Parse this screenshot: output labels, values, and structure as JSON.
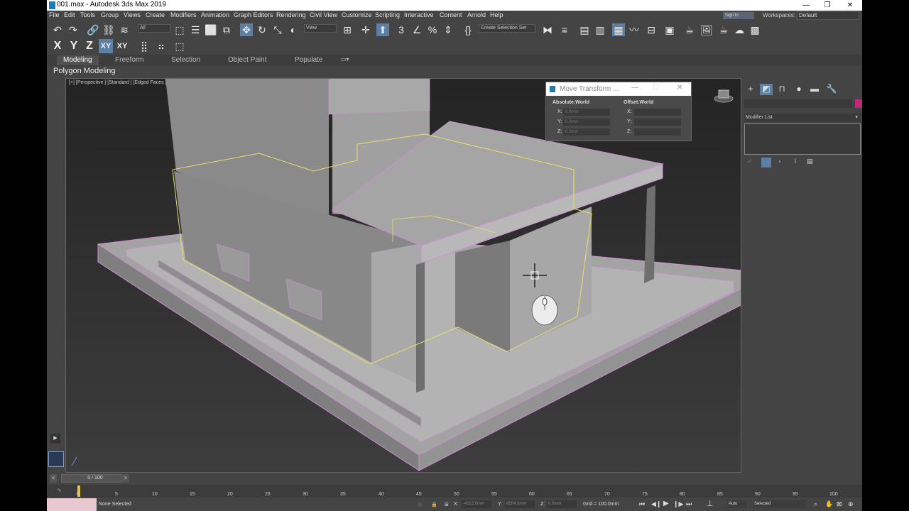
{
  "window": {
    "title": "001.max - Autodesk 3ds Max 2019",
    "min": "—",
    "max": "❐",
    "close": "✕"
  },
  "menubar": {
    "items": [
      "File",
      "Edit",
      "Tools",
      "Group",
      "Views",
      "Create",
      "Modifiers",
      "Animation",
      "Graph Editors",
      "Rendering",
      "Civil View",
      "Customize",
      "Scripting",
      "Interactive",
      "Content",
      "Arnold",
      "Help"
    ],
    "sign_in": "Sign In",
    "workspaces_label": "Workspaces:",
    "workspaces_value": "Default"
  },
  "toolbar": {
    "filter_value": "All",
    "refcoord_value": "View",
    "selection_set": "Create Selection Set"
  },
  "axes": {
    "x": "X",
    "y": "Y",
    "z": "Z",
    "xy": "XY",
    "xyz": "XY"
  },
  "ribbon": {
    "tabs": [
      "Modeling",
      "Freeform",
      "Selection",
      "Object Paint",
      "Populate"
    ],
    "subtitle": "Polygon Modeling"
  },
  "viewport": {
    "label": "[+] [Perspective ] [Standard ] [Edged Faces ]"
  },
  "dialog": {
    "title": "Move Transform ...",
    "absolute": "Absolute:World",
    "offset": "Offset:World",
    "axes": [
      "X:",
      "Y:",
      "Z:"
    ],
    "abs_values": [
      "0.0mm",
      "0.0mm",
      "0.0mm"
    ],
    "offset_values": [
      "",
      "",
      ""
    ]
  },
  "cmdpanel": {
    "modifier_list": "Modifier List"
  },
  "timeline": {
    "frame": "0 / 100",
    "ticks": [
      "0",
      "5",
      "10",
      "15",
      "20",
      "25",
      "30",
      "35",
      "40",
      "45",
      "50",
      "55",
      "60",
      "65",
      "70",
      "75",
      "80",
      "85",
      "90",
      "95",
      "100"
    ]
  },
  "status": {
    "selection": "None Selected",
    "x_label": "X:",
    "x_value": "-4113.9mm",
    "y_label": "Y:",
    "y_value": "8504.9mm",
    "z_label": "Z:",
    "z_value": "0.0mm",
    "grid": "Grid = 100.0mm",
    "auto": "Auto",
    "selected": "Selected"
  },
  "colors": {
    "accent": "#5b7fa5",
    "selection_edge": "#e7e06a",
    "model_edge": "#d28cd6",
    "object_color": "#c2287a"
  }
}
